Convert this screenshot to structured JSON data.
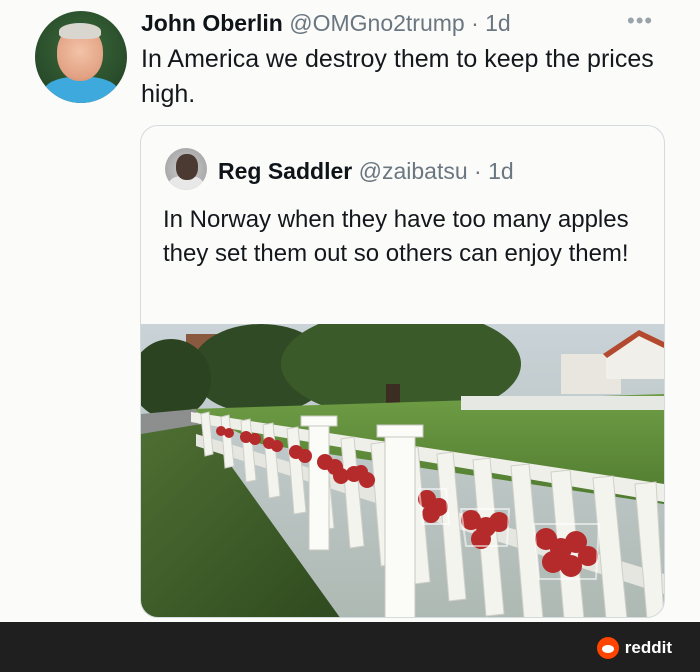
{
  "tweet": {
    "author_name": "John Oberlin",
    "author_handle": "@OMGno2trump · 1d",
    "more_label": "•••",
    "text": "In America we destroy them to keep the prices high."
  },
  "quoted_tweet": {
    "author_name": "Reg Saddler",
    "author_handle": "@zaibatsu · 1d",
    "text": "In Norway when they have too many apples they set them out so others can enjoy them!",
    "image_icon": "photo-of-apple-bags-on-white-picket-fence"
  },
  "footer": {
    "brand_label": "reddit",
    "brand_icon": "reddit-logo-icon",
    "brand_color": "#ff4500"
  }
}
